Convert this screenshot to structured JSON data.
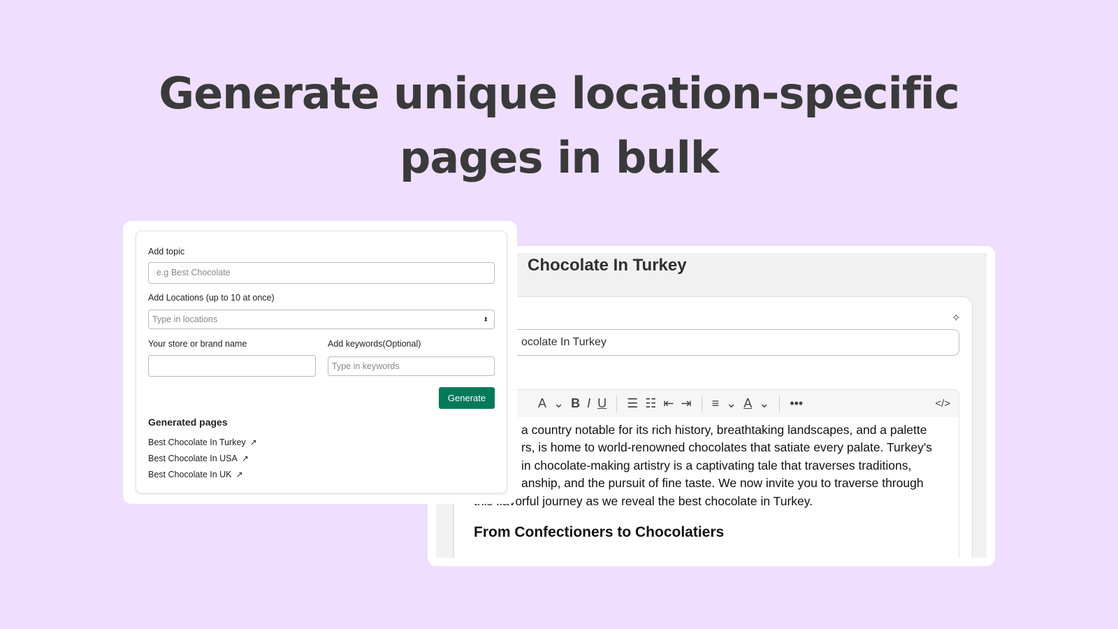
{
  "hero": {
    "line1": "Generate unique location-specific",
    "line2": "pages in bulk"
  },
  "form": {
    "topic_label": "Add topic",
    "topic_placeholder": "e.g Best Chocolate",
    "locations_label": "Add Locations (up to 10 at once)",
    "locations_placeholder": "Type in locations",
    "brand_label": "Your store or brand name",
    "brand_value": "",
    "keywords_label": "Add keywords(Optional)",
    "keywords_placeholder": "Type in keywords",
    "generate_label": "Generate",
    "generated_title": "Generated pages",
    "generated_pages": [
      "Best Chocolate In Turkey",
      "Best Chocolate In USA",
      "Best Chocolate In UK"
    ]
  },
  "editor": {
    "page_title": "Chocolate In Turkey",
    "title_field": "ocolate In Turkey",
    "toolbar": {
      "font": "A",
      "bold": "B",
      "italic": "I",
      "underline": "U",
      "bullets": "☰",
      "numbered": "☷",
      "outdent": "⇤",
      "indent": "⇥",
      "align": "≡",
      "color": "A",
      "more": "•••",
      "code": "</>",
      "chevron": "⌄"
    },
    "body_lines": [
      "a country notable for its rich history, breathtaking landscapes, and a palette",
      "rs, is home to world-renowned chocolates that satiate every palate. Turkey's",
      " in chocolate-making artistry is a captivating tale that traverses traditions,",
      "anship, and the pursuit of fine taste. We now invite you to traverse through",
      "this flavorful journey as we reveal the best chocolate in Turkey."
    ],
    "heading": "From Confectioners to Chocolatiers"
  },
  "colors": {
    "background": "#efdefe",
    "accent": "#017a5a"
  }
}
